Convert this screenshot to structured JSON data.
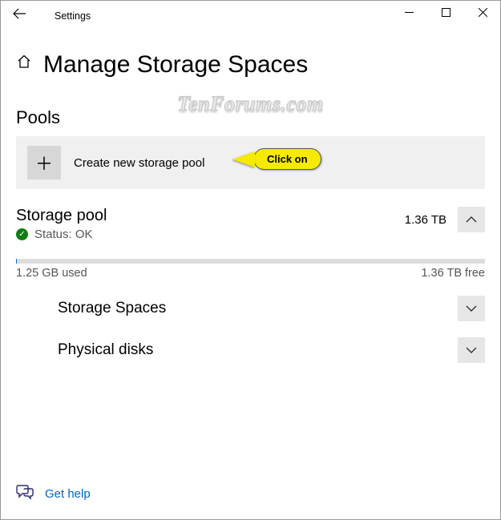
{
  "window": {
    "app_title": "Settings"
  },
  "header": {
    "page_title": "Manage Storage Spaces"
  },
  "watermark": "TenForums.com",
  "pools": {
    "heading": "Pools",
    "create_label": "Create new storage pool",
    "annotation": "Click on"
  },
  "pool": {
    "name": "Storage pool",
    "status_label": "Status: OK",
    "size": "1.36 TB",
    "used_label": "1.25 GB used",
    "free_label": "1.36 TB free"
  },
  "sections": {
    "storage_spaces": "Storage Spaces",
    "physical_disks": "Physical disks"
  },
  "help": {
    "label": "Get help"
  }
}
